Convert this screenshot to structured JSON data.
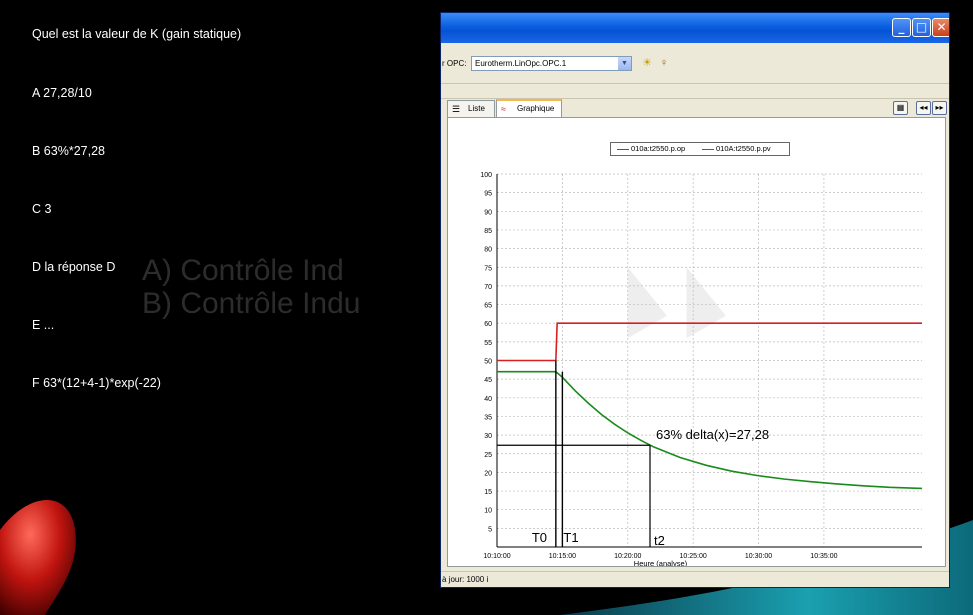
{
  "slide": {
    "question": "Quel est la valeur de K  (gain statique)",
    "options": [
      "A 27,28/10",
      "B 63%*27,28",
      "C 3",
      "D la réponse D",
      "E ...",
      "F 63*(12+4-1)*exp(-22)"
    ],
    "ghost_lines": [
      "A) Contrôle Ind",
      "B) Contrôle Indu"
    ]
  },
  "window": {
    "opc_label": "r OPC:",
    "opc_server": "Eurotherm.LinOpc.OPC.1",
    "tabs": [
      {
        "label": "Liste"
      },
      {
        "label": "Graphique"
      }
    ],
    "status": "à jour:  1000 i"
  },
  "chart_data": {
    "type": "line",
    "title": "",
    "xlabel": "Heure (analyse)",
    "ylabel": "",
    "ylim": [
      0,
      100
    ],
    "yticks": [
      5,
      10,
      15,
      20,
      25,
      30,
      35,
      40,
      45,
      50,
      55,
      60,
      65,
      70,
      75,
      80,
      85,
      90,
      95,
      100
    ],
    "xticks": [
      "10:10:00",
      "10:15:00",
      "10:20:00",
      "10:25:00",
      "10:30:00",
      "10:35:00"
    ],
    "xlim_minutes": [
      0,
      32.5
    ],
    "grid": true,
    "legend_position": "top",
    "series": [
      {
        "name": "010a:t2550.p.op",
        "color": "#d62020",
        "x": [
          0,
          4.5,
          4.6,
          32.5
        ],
        "y": [
          50,
          50,
          60,
          60
        ]
      },
      {
        "name": "010A:t2550.p.pv",
        "color": "#1a8a1a",
        "x": [
          0,
          4.5,
          5,
          6,
          7,
          8,
          9,
          10,
          11,
          12,
          14,
          16,
          18,
          20,
          22,
          24,
          26,
          28,
          30,
          32.5
        ],
        "y": [
          47,
          47,
          45.5,
          41.8,
          38.5,
          35.5,
          32.9,
          30.6,
          28.6,
          26.8,
          24.0,
          21.9,
          20.3,
          19.1,
          18.2,
          17.5,
          16.9,
          16.4,
          16.0,
          15.7
        ]
      }
    ],
    "annotations": [
      {
        "text": "63% delta(x)=27,28",
        "x": 12,
        "y": 27.28
      },
      {
        "text": "T0",
        "x": 4.5,
        "y": 3
      },
      {
        "text": "T1",
        "x": 5.2,
        "y": 3
      },
      {
        "text": "t2",
        "x": 11.7,
        "y": 3
      }
    ],
    "markers": {
      "t0": 4.5,
      "t1": 5.0,
      "t2": 11.7,
      "h_level": 27.28,
      "t0_level": 50,
      "t1_level": 47
    }
  }
}
